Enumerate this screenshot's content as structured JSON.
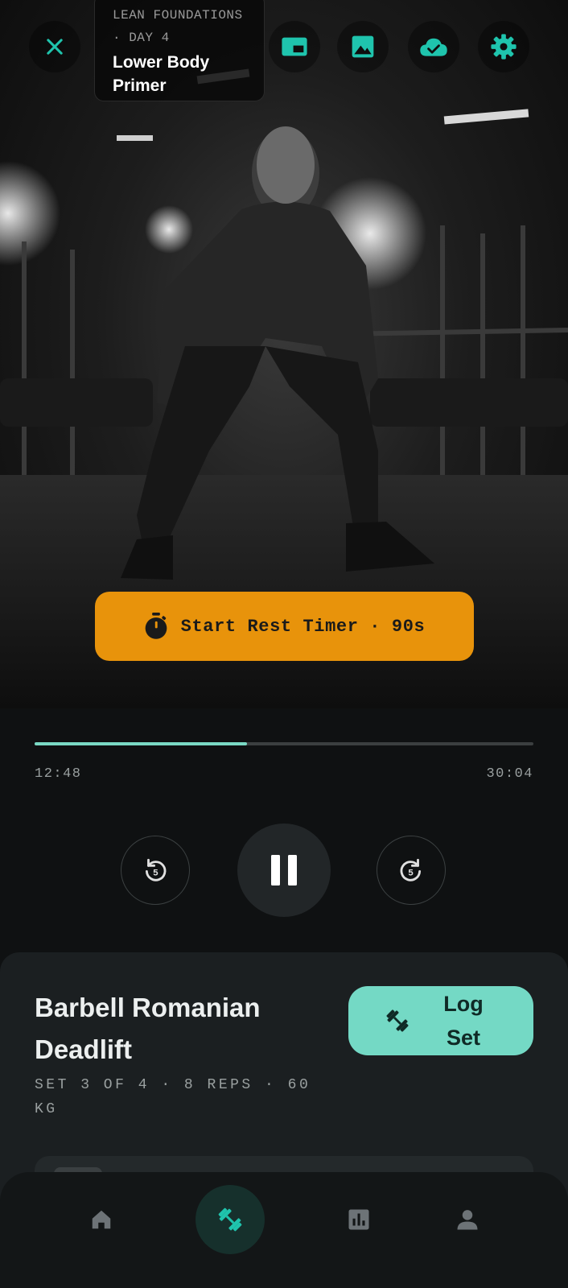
{
  "header": {
    "program_kicker": "LEAN FOUNDATIONS · DAY 4",
    "workout_title": "Lower Body Primer",
    "icons": [
      "close-icon",
      "picture-in-picture-icon",
      "image-icon",
      "cloud-done-icon",
      "settings-icon"
    ]
  },
  "hero": {
    "rest_timer_label": "Start Rest Timer · 90s",
    "rest_timer_icon": "stopwatch-icon"
  },
  "player": {
    "elapsed": "12:48",
    "duration": "30:04",
    "progress_fraction": 0.4256,
    "rewind_icon": "replay-5-icon",
    "play_state_icon": "pause-icon",
    "forward_icon": "forward-5-icon"
  },
  "exercise": {
    "name": "Barbell Romanian Deadlift",
    "meta": "SET 3 OF 4 · 8 REPS · 60 KG",
    "log_button_label": "Log Set",
    "log_button_icon": "dumbbell-icon"
  },
  "nav": {
    "items": [
      {
        "icon": "home-icon",
        "active": false
      },
      {
        "icon": "dumbbell-icon",
        "active": true
      },
      {
        "icon": "stats-icon",
        "active": false
      },
      {
        "icon": "profile-icon",
        "active": false
      }
    ]
  },
  "colors": {
    "accent": "#74d9c5",
    "accent_dark_bg": "#16302c",
    "timer_button": "#e8930b",
    "progress": "#7ad9c4",
    "icon_teal": "#1fc4ad",
    "nav_inactive": "#6d7377"
  }
}
